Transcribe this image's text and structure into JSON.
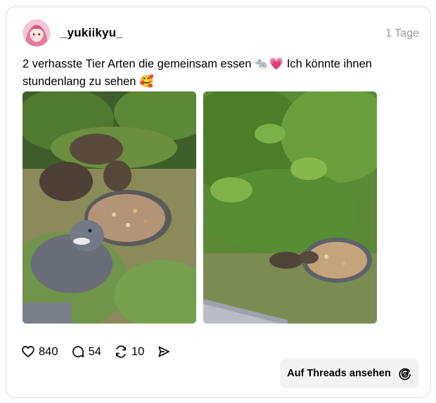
{
  "post": {
    "username": "_yukiikyu_",
    "timestamp": "1 Tage",
    "caption": "2 verhasste Tier Arten die gemeinsam essen 🐀💗 Ich könnte ihnen stundenlang zu sehen 🥰",
    "images": [
      {
        "icon": "rats-and-pigeon-feeding-photo"
      },
      {
        "icon": "rats-at-bowl-photo"
      }
    ]
  },
  "actions": {
    "likes": "840",
    "comments": "54",
    "reposts": "10"
  },
  "view_button": {
    "label": "Auf Threads ansehen",
    "icon": "threads-logo-icon"
  },
  "colors": {
    "border": "#dcdcdc",
    "muted": "#999999",
    "button_bg": "#f3f3f3"
  }
}
